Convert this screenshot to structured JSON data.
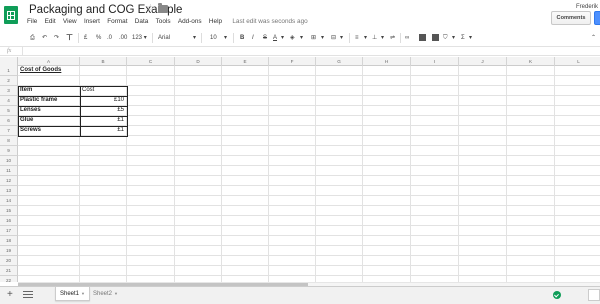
{
  "doc": {
    "title": "Packaging and COG Example",
    "user": "Frederik"
  },
  "menu": [
    "File",
    "Edit",
    "View",
    "Insert",
    "Format",
    "Data",
    "Tools",
    "Add-ons",
    "Help"
  ],
  "last_edit": "Last edit was seconds ago",
  "buttons": {
    "comments": "Comments"
  },
  "toolbar": {
    "currency": "£",
    "percent": "%",
    "dec_less": ".0",
    "dec_more": ".00",
    "more_formats": "123",
    "font": "Arial",
    "font_size": "10",
    "bold": "B",
    "italic": "I",
    "strike": "S",
    "text_color": "A",
    "sum": "Σ",
    "fx": "fx"
  },
  "columns": [
    "A",
    "B",
    "C",
    "D",
    "E",
    "F",
    "G",
    "H",
    "I",
    "J",
    "K",
    "L"
  ],
  "rows": [
    "1",
    "2",
    "3",
    "4",
    "5",
    "6",
    "7",
    "8",
    "9",
    "10",
    "11",
    "12",
    "13",
    "14",
    "15",
    "16",
    "17",
    "18",
    "19",
    "20",
    "21",
    "22"
  ],
  "cells": {
    "a1": "Cost of Goods",
    "a3": "Item",
    "b3": "Cost",
    "a4": "Plastic frame",
    "b4": "£10",
    "a5": "Lenses",
    "b5": "£5",
    "a6": "Glue",
    "b6": "£1",
    "a7": "Screws",
    "b7": "£1"
  },
  "sheets": [
    {
      "label": "Sheet1",
      "active": true
    },
    {
      "label": "Sheet2",
      "active": false
    }
  ],
  "colors": {
    "brand": "#0f9d58",
    "share": "#4d90fe"
  }
}
